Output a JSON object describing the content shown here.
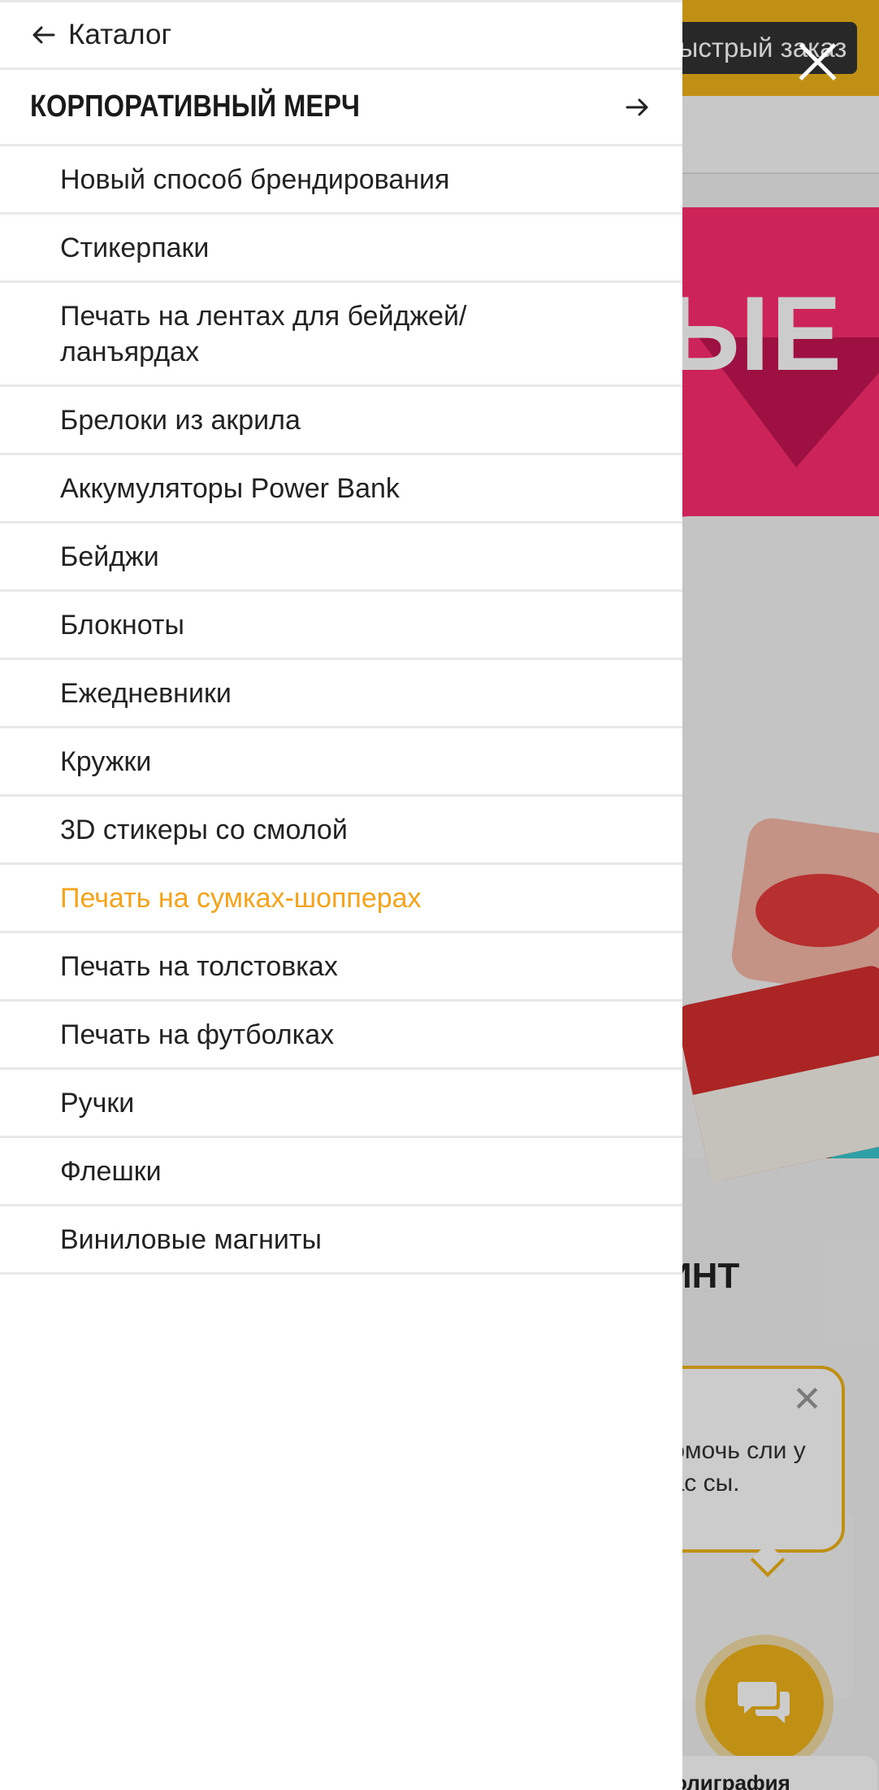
{
  "background": {
    "quick_order_label": "Быстрый заказ",
    "banner_text": "ЫЕ",
    "heading_fragment": "ИНТ",
    "chat_bubble_text": "помочь сли у вас сы.",
    "bottom_card_fragment": "олиграфия"
  },
  "drawer": {
    "back_label": "Каталог",
    "section_title": "КОРПОРАТИВНЫЙ МЕРЧ",
    "items": [
      {
        "label": "Новый способ брендирования",
        "active": false
      },
      {
        "label": "Стикерпаки",
        "active": false
      },
      {
        "label": "Печать на лентах для бейджей/ ланъярдах",
        "active": false
      },
      {
        "label": "Брелоки из акрила",
        "active": false
      },
      {
        "label": "Аккумуляторы Power Bank",
        "active": false
      },
      {
        "label": "Бейджи",
        "active": false
      },
      {
        "label": "Блокноты",
        "active": false
      },
      {
        "label": "Ежедневники",
        "active": false
      },
      {
        "label": "Кружки",
        "active": false
      },
      {
        "label": "3D стикеры со смолой",
        "active": false
      },
      {
        "label": "Печать на сумках-шопперах",
        "active": true
      },
      {
        "label": "Печать на толстовках",
        "active": false
      },
      {
        "label": "Печать на футболках",
        "active": false
      },
      {
        "label": "Ручки",
        "active": false
      },
      {
        "label": "Флешки",
        "active": false
      },
      {
        "label": "Виниловые магниты",
        "active": false
      }
    ]
  },
  "colors": {
    "accent": "#f5a31a",
    "brand_yellow": "#f0b41a",
    "text": "#222222",
    "divider": "#e8e8e8"
  },
  "icons": {
    "back": "arrow-left-icon",
    "section": "arrow-right-icon",
    "close": "close-icon",
    "chat": "chat-icon"
  }
}
